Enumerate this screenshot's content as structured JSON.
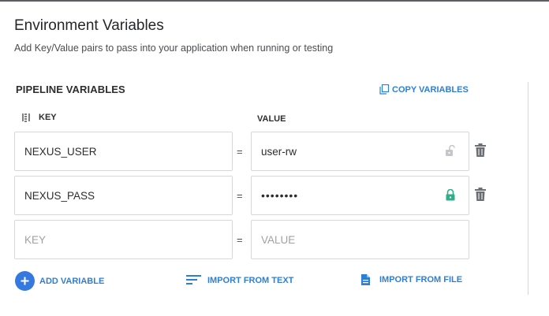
{
  "header": {
    "title": "Environment Variables",
    "subtitle": "Add Key/Value pairs to pass into your application when running or testing"
  },
  "pipeline": {
    "section_title": "PIPELINE VARIABLES",
    "copy_label": "COPY VARIABLES",
    "key_header": "KEY",
    "value_header": "VALUE",
    "separator": "=",
    "rows": [
      {
        "key": "NEXUS_USER",
        "value": "user-rw",
        "locked": false
      },
      {
        "key": "NEXUS_PASS",
        "value": "••••••••",
        "locked": true
      }
    ],
    "new_row": {
      "key_placeholder": "KEY",
      "value_placeholder": "VALUE"
    }
  },
  "actions": {
    "add_variable": "ADD VARIABLE",
    "import_text": "IMPORT FROM TEXT",
    "import_file": "IMPORT FROM FILE"
  },
  "colors": {
    "accent": "#2d7fd6",
    "add_button": "#3579e0",
    "lock_active": "#2fae8a",
    "lock_inactive": "#c4c7ca",
    "trash": "#6b6e72"
  },
  "icons": {
    "copy": "copy-icon",
    "sort": "sort-icon",
    "lock_open": "unlock-icon",
    "lock_closed": "lock-icon",
    "trash": "trash-icon",
    "add": "plus-icon",
    "text": "text-lines-icon",
    "file": "file-icon"
  }
}
